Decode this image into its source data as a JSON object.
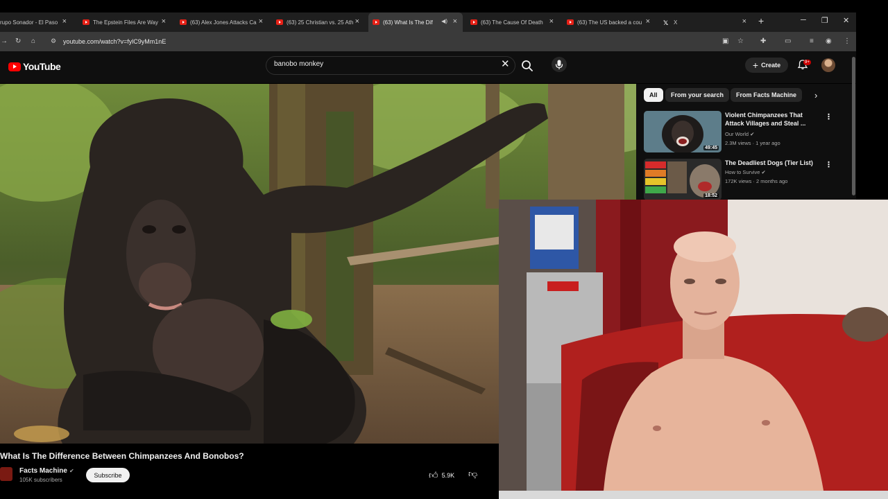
{
  "browser": {
    "tabs": [
      {
        "title": "rupo Sonador - El Paso",
        "icon": "red-favicon"
      },
      {
        "title": "The Epstein Files Are Way",
        "icon": "youtube-icon"
      },
      {
        "title": "(63) Alex Jones Attacks Ca",
        "icon": "youtube-icon"
      },
      {
        "title": "(63) 25 Christian vs. 25 Ath",
        "icon": "youtube-icon"
      },
      {
        "title": "(63) What Is The Diffe",
        "icon": "youtube-icon",
        "active": true
      },
      {
        "title": "(63) The Cause Of Death",
        "icon": "youtube-icon"
      },
      {
        "title": "(63) The US backed a cou",
        "icon": "youtube-icon"
      },
      {
        "title": "X",
        "icon": "x-icon"
      }
    ],
    "url": "youtube.com/watch?v=fylC9yMm1nE"
  },
  "youtube": {
    "logo_text": "YouTube",
    "search": {
      "value": "banobo monkey",
      "placeholder": "Search"
    },
    "create_label": "Create",
    "notification_count": "9+"
  },
  "video": {
    "title": "What Is The Difference Between Chimpanzees And Bonobos?",
    "channel": "Facts Machine",
    "subscribers": "105K subscribers",
    "subscribe_label": "Subscribe",
    "likes": "5.9K"
  },
  "sidebar": {
    "chips": [
      "All",
      "From your search",
      "From Facts Machine"
    ],
    "recommendations": [
      {
        "title": "Violent Chimpanzees That Attack Villages and Steal ...",
        "channel": "Our World",
        "meta": "2.3M views · 1 year ago",
        "duration": "49:45"
      },
      {
        "title": "The Deadliest Dogs (Tier List)",
        "channel": "How to Survive",
        "meta": "172K views · 2 months ago",
        "duration": "18:52"
      }
    ]
  },
  "colors": {
    "youtube_red": "#ff0000",
    "dark_bg": "#0f0f0f",
    "chip_bg": "#272727"
  }
}
